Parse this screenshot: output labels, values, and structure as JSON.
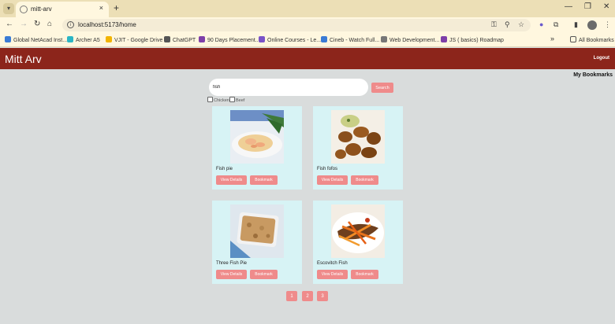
{
  "browser": {
    "tab_title": "mitt-arv",
    "tab_close": "×",
    "new_tab": "+",
    "url": "localhost:5173/home",
    "bookmarks": [
      {
        "label": "Global NetAcad Inst...",
        "icon": "netacad-icon",
        "color": "#3a7bd5"
      },
      {
        "label": "Archer A5",
        "icon": "archer-icon",
        "color": "#2bb5c5"
      },
      {
        "label": "VJIT - Google Drive",
        "icon": "drive-icon",
        "color": "#f2b400"
      },
      {
        "label": "ChatGPT",
        "icon": "chatgpt-icon",
        "color": "#555555"
      },
      {
        "label": "90 Days Placement...",
        "icon": "placement-icon",
        "color": "#7e3fa8"
      },
      {
        "label": "Online Courses - Le...",
        "icon": "courses-icon",
        "color": "#7a53c8"
      },
      {
        "label": "Cineb - Watch Full...",
        "icon": "cineb-icon",
        "color": "#3a7bd5"
      },
      {
        "label": "Web Development...",
        "icon": "webdev-icon",
        "color": "#777777"
      },
      {
        "label": "JS ( basics) Roadmap",
        "icon": "roadmap-icon",
        "color": "#7e3fa8"
      }
    ],
    "more_bookmarks": "»",
    "all_bookmarks": "All Bookmarks"
  },
  "header": {
    "title": "Mitt Arv",
    "logout": "Logout",
    "bg_color": "#8c251b"
  },
  "my_bookmarks": "My Bookmarks",
  "search": {
    "value": "fish",
    "button": "Search"
  },
  "filters": [
    {
      "label": "Chicken",
      "checked": false
    },
    {
      "label": "Beef",
      "checked": false
    }
  ],
  "cards": [
    {
      "name": "Fish pie",
      "details": "View Details",
      "bookmark": "Bookmark"
    },
    {
      "name": "Fish fofos",
      "details": "View Details",
      "bookmark": "Bookmark"
    },
    {
      "name": "Three Fish Pie",
      "details": "View Details",
      "bookmark": "Bookmark"
    },
    {
      "name": "Escovitch Fish",
      "details": "View Details",
      "bookmark": "Bookmark"
    }
  ],
  "pagination": [
    "1",
    "2",
    "3"
  ],
  "accent_color": "#ef8b8b",
  "card_color": "#d7f3f5"
}
